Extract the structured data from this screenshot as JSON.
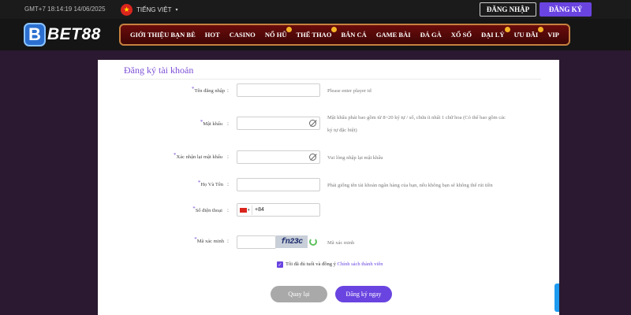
{
  "topbar": {
    "time": "GMT+7 18:14:19 14/06/2025",
    "language": "TIẾNG VIỆT",
    "login_label": "ĐĂNG NHẬP",
    "register_label": "ĐĂNG KÝ"
  },
  "brand": {
    "logo_letter": "B",
    "logo_text": "BET88"
  },
  "nav": {
    "items": [
      {
        "label": "GIỚI THIỆU BẠN BÈ"
      },
      {
        "label": "HOT"
      },
      {
        "label": "CASINO"
      },
      {
        "label": "NỔ HŨ"
      },
      {
        "label": "THỂ THAO"
      },
      {
        "label": "BẮN CÁ"
      },
      {
        "label": "GAME BÀI"
      },
      {
        "label": "ĐÁ GÀ"
      },
      {
        "label": "XỔ SỐ"
      },
      {
        "label": "ĐẠI LÝ"
      },
      {
        "label": "ƯU ĐÃI"
      },
      {
        "label": "VIP"
      }
    ]
  },
  "form": {
    "title": "Đăng ký tài khoản",
    "fields": {
      "username": {
        "label": "Tên đăng nhập",
        "hint": "Please enter player id"
      },
      "password": {
        "label": "Mật khẩu",
        "hint_line1": "Mật khẩu phải bao gồm từ 8~20 ký tự / số, chứa ít nhất 1 chữ hoa (Có thể bao gồm các",
        "hint_line2": "ký tự đặc biệt)"
      },
      "confirm_password": {
        "label": "Xác nhận lại mật khẩu",
        "hint": "Vui lòng nhập lại mật khẩu"
      },
      "full_name": {
        "label": "Họ Và Tên",
        "hint": "Phải giống tên tài khoản ngân hàng của bạn, nếu không bạn sẽ không thể rút tiền"
      },
      "phone": {
        "label": "Số điện thoại",
        "code": "+84"
      },
      "captcha": {
        "label": "Mã xác minh",
        "code": "fn23c",
        "hint": "Mã xác minh"
      }
    },
    "agree_text": "Tôi đã đủ tuổi và đồng ý",
    "policy_link": "Chính sách thành viên",
    "back_label": "Quay lại",
    "submit_label": "Đăng ký ngay"
  },
  "colors": {
    "accent": "#6a44e0",
    "nav_bg": "#5a0a0a",
    "nav_border": "#c7813f",
    "page_bg": "#2a1930"
  }
}
